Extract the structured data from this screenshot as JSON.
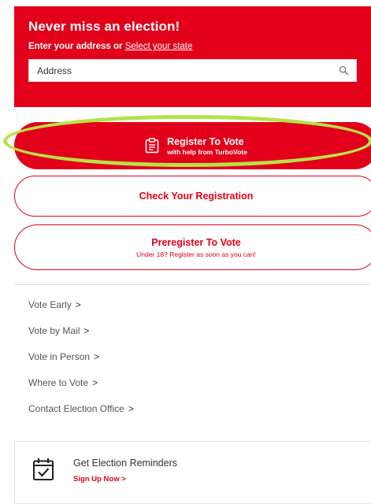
{
  "hero": {
    "title": "Never miss an election!",
    "subtitle_prefix": "Enter your address",
    "subtitle_or": "or",
    "select_state_link": "Select your state",
    "search_placeholder": "Address"
  },
  "buttons": {
    "register": {
      "label": "Register To Vote",
      "sublabel": "with help from TurboVote"
    },
    "check": {
      "label": "Check Your Registration"
    },
    "preregister": {
      "label": "Preregister To Vote",
      "sublabel": "Under 18? Register as soon as you can!"
    }
  },
  "links": [
    {
      "label": "Vote Early",
      "chevron": ">"
    },
    {
      "label": "Vote by Mail",
      "chevron": ">"
    },
    {
      "label": "Vote in Person",
      "chevron": ">"
    },
    {
      "label": "Where to Vote",
      "chevron": ">"
    },
    {
      "label": "Contact Election Office",
      "chevron": ">"
    }
  ],
  "reminders": {
    "title": "Get Election Reminders",
    "link": "Sign Up Now",
    "chevron": ">"
  },
  "colors": {
    "brand_red": "#e2001a",
    "highlight": "#b8e246"
  },
  "icons": [
    "search-icon",
    "clipboard-icon",
    "calendar-check-icon"
  ]
}
